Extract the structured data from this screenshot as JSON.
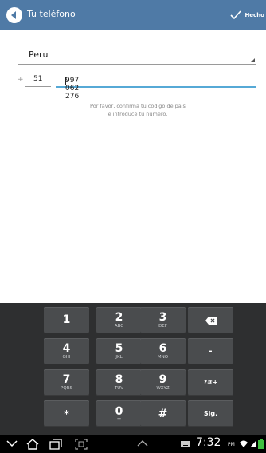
{
  "action_bar": {
    "title": "Tu teléfono",
    "done_label": "Hecho",
    "back_icon": "back-arrow-icon",
    "done_icon": "check-icon",
    "background": "#4f7aa6"
  },
  "form": {
    "country_value": "Peru",
    "country_code_prefix": "+",
    "country_code": "51",
    "phone_number": "997 062 276",
    "hint_line1": "Por favor, confirma tu código de país",
    "hint_line2": "e introduce tu número.",
    "focus_color": "#56a9d6"
  },
  "keyboard": {
    "rows": [
      [
        {
          "main": "1",
          "sub": ""
        },
        {
          "main": "2",
          "sub": "ABC"
        },
        {
          "main": "3",
          "sub": "DEF"
        },
        {
          "icon": "backspace-icon"
        }
      ],
      [
        {
          "main": "4",
          "sub": "GHI"
        },
        {
          "main": "5",
          "sub": "JKL"
        },
        {
          "main": "6",
          "sub": "MNO"
        },
        {
          "main": "-",
          "sub": ""
        }
      ],
      [
        {
          "main": "7",
          "sub": "PQRS"
        },
        {
          "main": "8",
          "sub": "TUV"
        },
        {
          "main": "9",
          "sub": "WXYZ"
        },
        {
          "main": "?#+",
          "sub": ""
        }
      ],
      [
        {
          "main": "*",
          "sub": ""
        },
        {
          "main": "0",
          "sub": "+"
        },
        {
          "main": "#",
          "sub": ""
        },
        {
          "main": "Sig.",
          "sub": ""
        }
      ]
    ]
  },
  "status_bar": {
    "time": "7:32",
    "am_pm": "PM",
    "icons": [
      "back-icon",
      "home-icon",
      "recent-apps-icon",
      "screenshot-icon",
      "up-arrow-icon",
      "keyboard-icon",
      "wifi-icon",
      "signal-icon",
      "battery-icon"
    ]
  }
}
